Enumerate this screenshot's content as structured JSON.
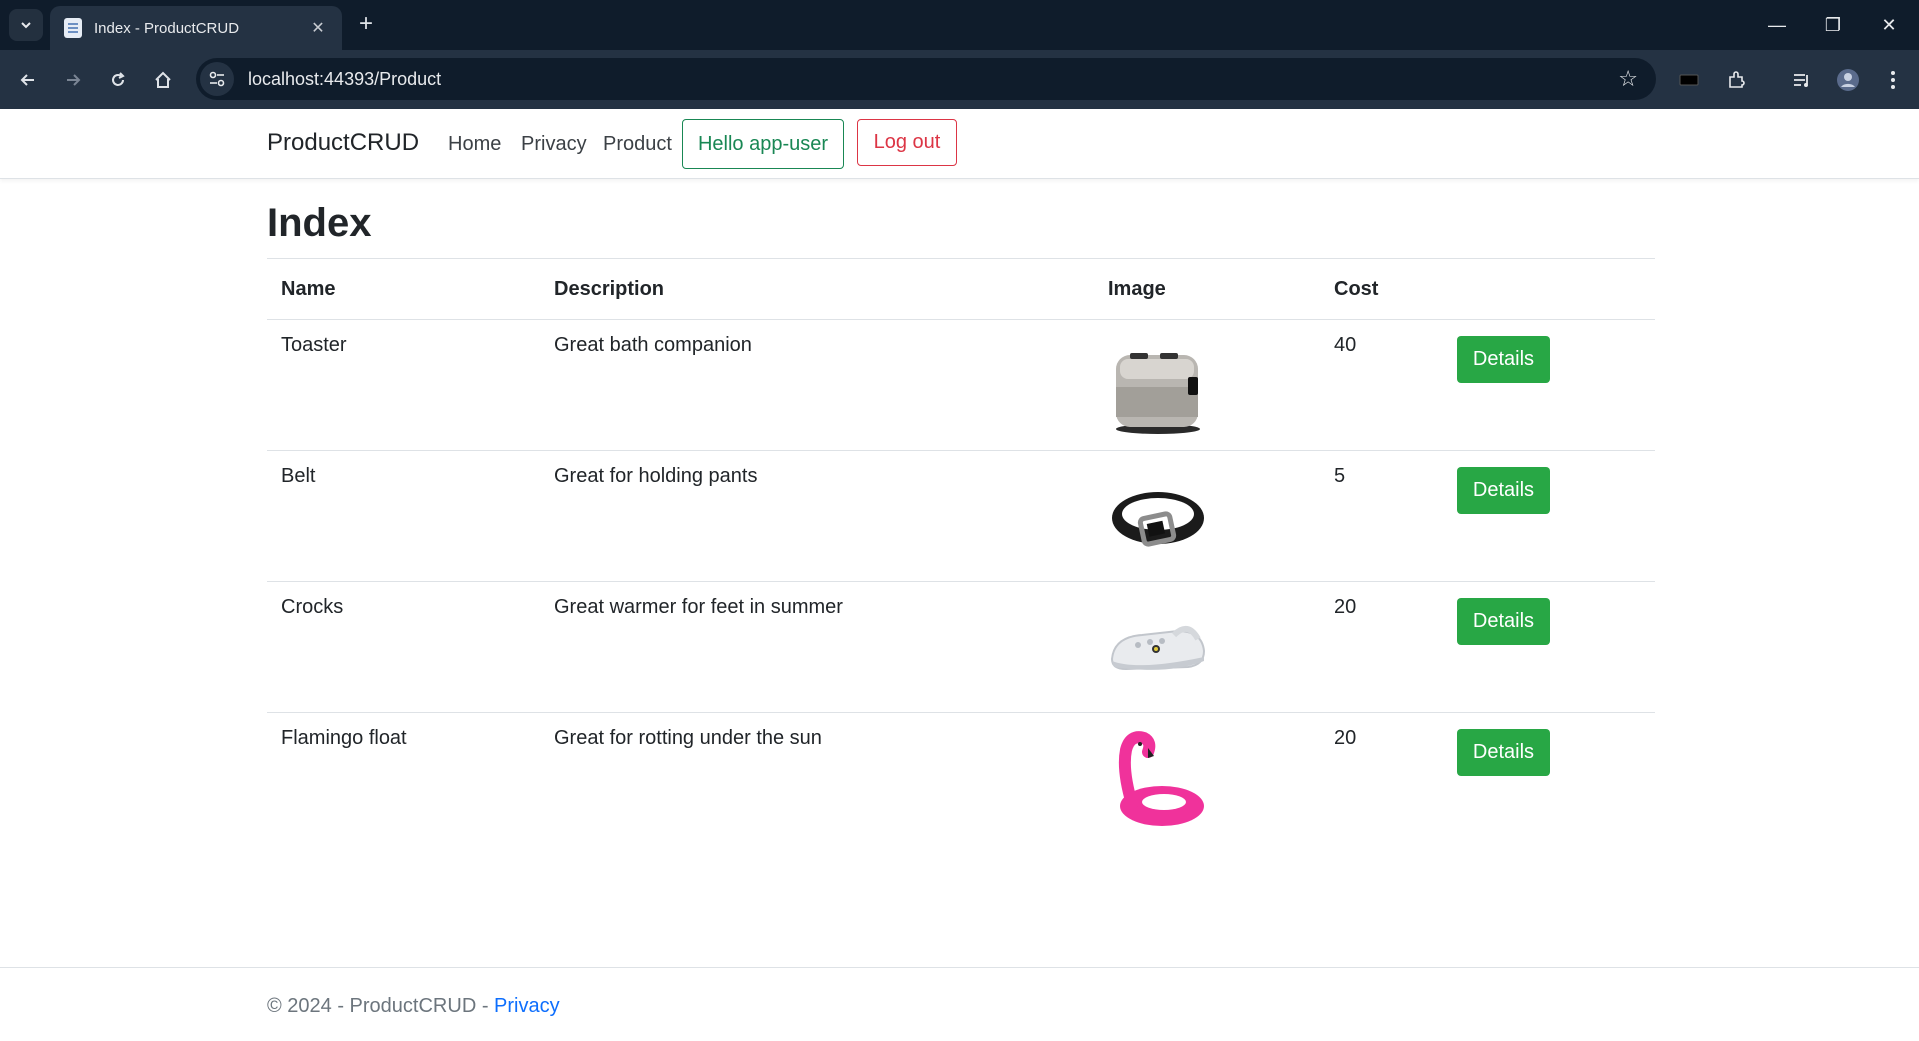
{
  "browser": {
    "tab_title": "Index - ProductCRUD",
    "tab_close": "✕",
    "new_tab": "+",
    "url": "localhost:44393/Product",
    "window_minimize": "—",
    "window_restore": "❐",
    "window_close": "✕"
  },
  "navbar": {
    "brand": "ProductCRUD",
    "links": [
      "Home",
      "Privacy",
      "Product"
    ],
    "hello": "Hello app-user",
    "logout": "Log out"
  },
  "page": {
    "title": "Index",
    "columns": [
      "Name",
      "Description",
      "Image",
      "Cost",
      ""
    ],
    "details_label": "Details",
    "rows": [
      {
        "name": "Toaster",
        "description": "Great bath companion",
        "image": "toaster-image",
        "cost": "40"
      },
      {
        "name": "Belt",
        "description": "Great for holding pants",
        "image": "belt-image",
        "cost": "5"
      },
      {
        "name": "Crocks",
        "description": "Great warmer for feet in summer",
        "image": "crocs-image",
        "cost": "20"
      },
      {
        "name": "Flamingo float",
        "description": "Great for rotting under the sun",
        "image": "flamingo-image",
        "cost": "20"
      }
    ]
  },
  "footer": {
    "text": "© 2024 - ProductCRUD - ",
    "link": "Privacy"
  },
  "colors": {
    "success": "#28a745",
    "success_outline": "#198754",
    "danger": "#dc3545",
    "link": "#0d6efd",
    "chrome_dark": "#0f1c2b",
    "chrome_toolbar": "#243243"
  }
}
